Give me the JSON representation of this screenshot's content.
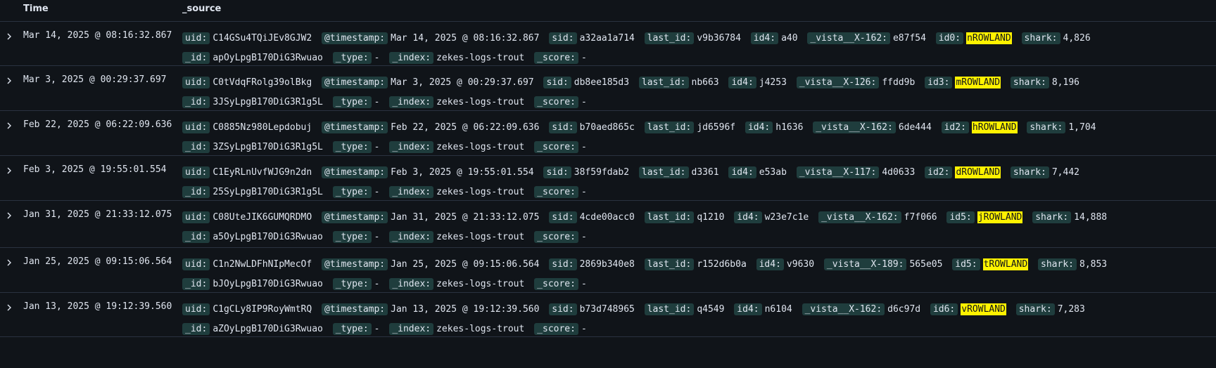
{
  "header": {
    "time_label": "Time",
    "source_label": "_source"
  },
  "icons": {
    "expand": "chevron-right-icon"
  },
  "colors": {
    "background": "#101419",
    "key_badge": "#1f3d3d",
    "highlight": "#fff200"
  },
  "rows": [
    {
      "time": "Mar 14, 2025 @ 08:16:32.867",
      "fields": [
        {
          "k": "uid:",
          "v": "C14GSu4TQiJEv8GJW2"
        },
        {
          "k": "@timestamp:",
          "v": "Mar 14, 2025 @ 08:16:32.867"
        },
        {
          "k": "sid:",
          "v": "a32aa1a714"
        },
        {
          "k": "last_id:",
          "v": "v9b36784"
        },
        {
          "k": "id4:",
          "v": "a40"
        },
        {
          "k": "_vista__X-162:",
          "v": "e87f54"
        },
        {
          "k": "id0:",
          "v": "nROWLAND",
          "hl": true
        },
        {
          "k": "shark:",
          "v": "4,826"
        },
        {
          "k": "_id:",
          "v": "apOyLpgB170DiG3Rwuao"
        },
        {
          "k": "_type:",
          "v": "-"
        },
        {
          "k": "_index:",
          "v": "zekes-logs-trout"
        },
        {
          "k": "_score:",
          "v": "-"
        }
      ]
    },
    {
      "time": "Mar 3, 2025 @ 00:29:37.697",
      "fields": [
        {
          "k": "uid:",
          "v": "C0tVdqFRolg39olBkg"
        },
        {
          "k": "@timestamp:",
          "v": "Mar 3, 2025 @ 00:29:37.697"
        },
        {
          "k": "sid:",
          "v": "db8ee185d3"
        },
        {
          "k": "last_id:",
          "v": "nb663"
        },
        {
          "k": "id4:",
          "v": "j4253"
        },
        {
          "k": "_vista__X-126:",
          "v": "ffdd9b"
        },
        {
          "k": "id3:",
          "v": "mROWLAND",
          "hl": true
        },
        {
          "k": "shark:",
          "v": "8,196"
        },
        {
          "k": "_id:",
          "v": "3JSyLpgB170DiG3R1g5L"
        },
        {
          "k": "_type:",
          "v": "-"
        },
        {
          "k": "_index:",
          "v": "zekes-logs-trout"
        },
        {
          "k": "_score:",
          "v": "-"
        }
      ]
    },
    {
      "time": "Feb 22, 2025 @ 06:22:09.636",
      "fields": [
        {
          "k": "uid:",
          "v": "C0885Nz980Lepdobuj"
        },
        {
          "k": "@timestamp:",
          "v": "Feb 22, 2025 @ 06:22:09.636"
        },
        {
          "k": "sid:",
          "v": "b70aed865c"
        },
        {
          "k": "last_id:",
          "v": "jd6596f"
        },
        {
          "k": "id4:",
          "v": "h1636"
        },
        {
          "k": "_vista__X-162:",
          "v": "6de444"
        },
        {
          "k": "id2:",
          "v": "hROWLAND",
          "hl": true
        },
        {
          "k": "shark:",
          "v": "1,704"
        },
        {
          "k": "_id:",
          "v": "3ZSyLpgB170DiG3R1g5L"
        },
        {
          "k": "_type:",
          "v": "-"
        },
        {
          "k": "_index:",
          "v": "zekes-logs-trout"
        },
        {
          "k": "_score:",
          "v": "-"
        }
      ]
    },
    {
      "time": "Feb 3, 2025 @ 19:55:01.554",
      "fields": [
        {
          "k": "uid:",
          "v": "C1EyRLnUvfWJG9n2dn"
        },
        {
          "k": "@timestamp:",
          "v": "Feb 3, 2025 @ 19:55:01.554"
        },
        {
          "k": "sid:",
          "v": "38f59fdab2"
        },
        {
          "k": "last_id:",
          "v": "d3361"
        },
        {
          "k": "id4:",
          "v": "e53ab"
        },
        {
          "k": "_vista__X-117:",
          "v": "4d0633"
        },
        {
          "k": "id2:",
          "v": "dROWLAND",
          "hl": true
        },
        {
          "k": "shark:",
          "v": "7,442"
        },
        {
          "k": "_id:",
          "v": "25SyLpgB170DiG3R1g5L"
        },
        {
          "k": "_type:",
          "v": "-"
        },
        {
          "k": "_index:",
          "v": "zekes-logs-trout"
        },
        {
          "k": "_score:",
          "v": "-"
        }
      ]
    },
    {
      "time": "Jan 31, 2025 @ 21:33:12.075",
      "fields": [
        {
          "k": "uid:",
          "v": "C08UteJIK6GUMQRDMO"
        },
        {
          "k": "@timestamp:",
          "v": "Jan 31, 2025 @ 21:33:12.075"
        },
        {
          "k": "sid:",
          "v": "4cde00acc0"
        },
        {
          "k": "last_id:",
          "v": "q1210"
        },
        {
          "k": "id4:",
          "v": "w23e7c1e"
        },
        {
          "k": "_vista__X-162:",
          "v": "f7f066"
        },
        {
          "k": "id5:",
          "v": "jROWLAND",
          "hl": true
        },
        {
          "k": "shark:",
          "v": "14,888"
        },
        {
          "k": "_id:",
          "v": "a5OyLpgB170DiG3Rwuao"
        },
        {
          "k": "_type:",
          "v": "-"
        },
        {
          "k": "_index:",
          "v": "zekes-logs-trout"
        },
        {
          "k": "_score:",
          "v": "-"
        }
      ]
    },
    {
      "time": "Jan 25, 2025 @ 09:15:06.564",
      "fields": [
        {
          "k": "uid:",
          "v": "C1n2NwLDFhNIpMecOf"
        },
        {
          "k": "@timestamp:",
          "v": "Jan 25, 2025 @ 09:15:06.564"
        },
        {
          "k": "sid:",
          "v": "2869b340e8"
        },
        {
          "k": "last_id:",
          "v": "r152d6b0a"
        },
        {
          "k": "id4:",
          "v": "v9630"
        },
        {
          "k": "_vista__X-189:",
          "v": "565e05"
        },
        {
          "k": "id5:",
          "v": "tROWLAND",
          "hl": true
        },
        {
          "k": "shark:",
          "v": "8,853"
        },
        {
          "k": "_id:",
          "v": "bJOyLpgB170DiG3Rwuao"
        },
        {
          "k": "_type:",
          "v": "-"
        },
        {
          "k": "_index:",
          "v": "zekes-logs-trout"
        },
        {
          "k": "_score:",
          "v": "-"
        }
      ]
    },
    {
      "time": "Jan 13, 2025 @ 19:12:39.560",
      "fields": [
        {
          "k": "uid:",
          "v": "C1gCLy8IP9RoyWmtRQ"
        },
        {
          "k": "@timestamp:",
          "v": "Jan 13, 2025 @ 19:12:39.560"
        },
        {
          "k": "sid:",
          "v": "b73d748965"
        },
        {
          "k": "last_id:",
          "v": "q4549"
        },
        {
          "k": "id4:",
          "v": "n6104"
        },
        {
          "k": "_vista__X-162:",
          "v": "d6c97d"
        },
        {
          "k": "id6:",
          "v": "vROWLAND",
          "hl": true
        },
        {
          "k": "shark:",
          "v": "7,283"
        },
        {
          "k": "_id:",
          "v": "aZOyLpgB170DiG3Rwuao"
        },
        {
          "k": "_type:",
          "v": "-"
        },
        {
          "k": "_index:",
          "v": "zekes-logs-trout"
        },
        {
          "k": "_score:",
          "v": "-"
        }
      ]
    }
  ]
}
